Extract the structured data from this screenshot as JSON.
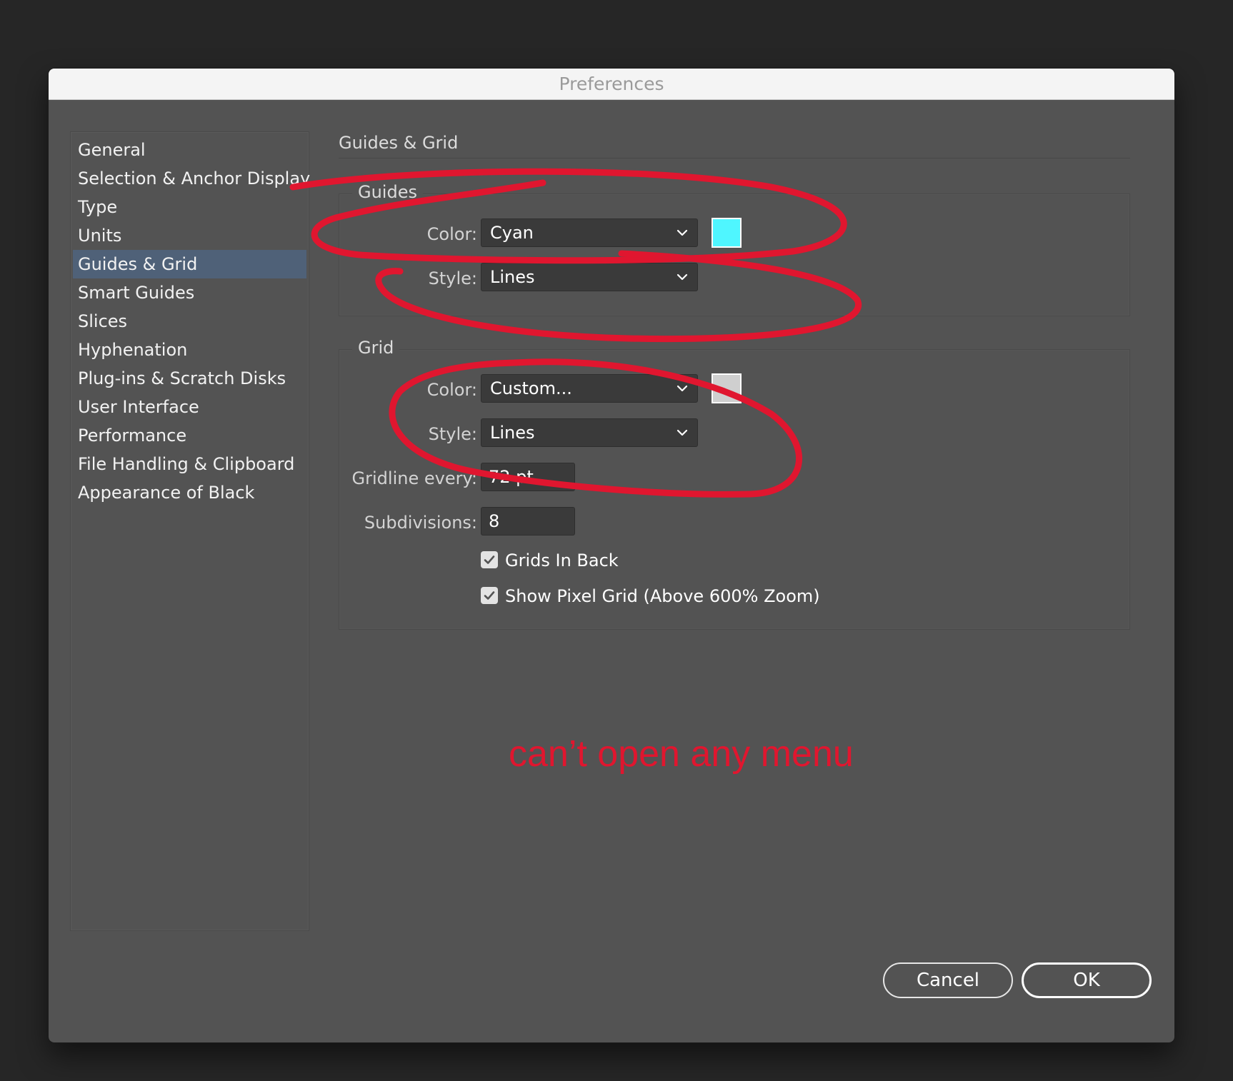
{
  "window": {
    "title": "Preferences"
  },
  "sidebar": {
    "items": [
      {
        "label": "General"
      },
      {
        "label": "Selection & Anchor Display"
      },
      {
        "label": "Type"
      },
      {
        "label": "Units"
      },
      {
        "label": "Guides & Grid",
        "selected": true
      },
      {
        "label": "Smart Guides"
      },
      {
        "label": "Slices"
      },
      {
        "label": "Hyphenation"
      },
      {
        "label": "Plug-ins & Scratch Disks"
      },
      {
        "label": "User Interface"
      },
      {
        "label": "Performance"
      },
      {
        "label": "File Handling & Clipboard"
      },
      {
        "label": "Appearance of Black"
      }
    ]
  },
  "panel": {
    "title": "Guides & Grid",
    "guides": {
      "legend": "Guides",
      "color_label": "Color:",
      "color_value": "Cyan",
      "color_swatch": "#4ff6ff",
      "style_label": "Style:",
      "style_value": "Lines"
    },
    "grid": {
      "legend": "Grid",
      "color_label": "Color:",
      "color_value": "Custom...",
      "color_swatch": "#cfcfcf",
      "style_label": "Style:",
      "style_value": "Lines",
      "gridline_label": "Gridline every:",
      "gridline_value": "72 pt",
      "subdivisions_label": "Subdivisions:",
      "subdivisions_value": "8",
      "grids_in_back": {
        "label": "Grids In Back",
        "checked": true
      },
      "show_pixel_grid": {
        "label": "Show Pixel Grid (Above 600% Zoom)",
        "checked": true
      }
    }
  },
  "buttons": {
    "cancel": "Cancel",
    "ok": "OK"
  },
  "annotation": {
    "text": "can’t open any menu",
    "color": "#e0162f"
  },
  "icons": {
    "dropdown": "chevron-down-icon",
    "check": "checkmark-icon"
  },
  "colors": {
    "selection": "#4f6178",
    "panel": "#535353",
    "backdrop": "#262626"
  }
}
